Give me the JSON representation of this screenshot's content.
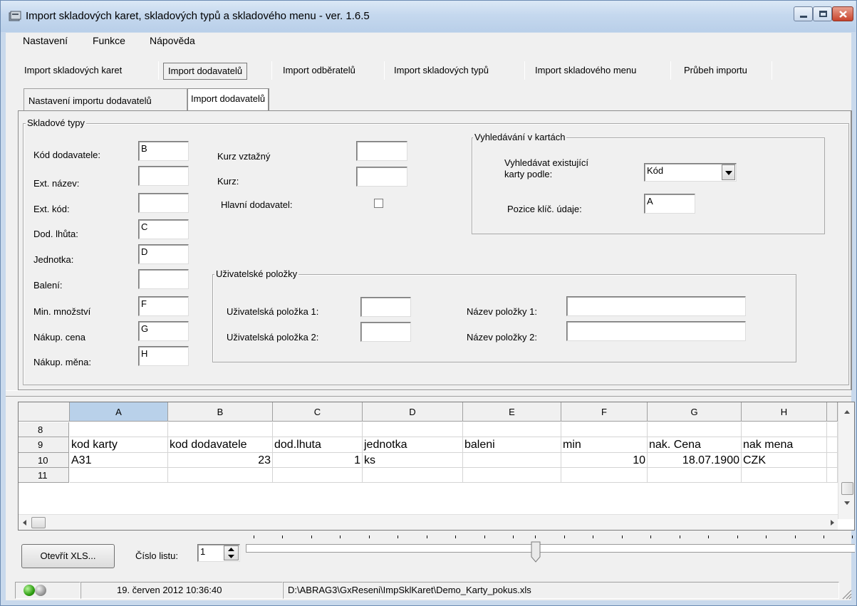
{
  "window": {
    "title": "Import skladových karet, skladových typů a skladového menu - ver. 1.6.5"
  },
  "menu": [
    "Nastavení",
    "Funkce",
    "Nápověda"
  ],
  "main_tabs": [
    "Import skladových karet",
    "Import dodavatelů",
    "Import odběratelů",
    "Import skladových typů",
    "Import skladového menu",
    "Průbeh importu"
  ],
  "sub_tabs": [
    "Nastavení importu dodavatelů",
    "Import dodavatelů"
  ],
  "skladove_typy": {
    "title": "Skladové typy",
    "fields": [
      {
        "label": "Kód dodavatele:",
        "value": "B"
      },
      {
        "label": "Ext. název:",
        "value": ""
      },
      {
        "label": "Ext. kód:",
        "value": ""
      },
      {
        "label": "Dod. lhůta:",
        "value": "C"
      },
      {
        "label": "Jednotka:",
        "value": "D"
      },
      {
        "label": "Balení:",
        "value": ""
      },
      {
        "label": "Min. množství",
        "value": "F"
      },
      {
        "label": "Nákup. cena",
        "value": "G"
      },
      {
        "label": "Nákup. měna:",
        "value": "H"
      }
    ],
    "kurz_vztazny_label": "Kurz vztažný",
    "kurz_vztazny_value": "",
    "kurz_label": "Kurz:",
    "kurz_value": "",
    "hlavni_dodavatel_label": "Hlavní dodavatel:"
  },
  "vyhledavani": {
    "title": "Vyhledávání v kartách",
    "search_label_1": "Vyhledávat existující",
    "search_label_2": "karty podle:",
    "search_value": "Kód",
    "pozice_label": "Pozice klíč. údaje:",
    "pozice_value": "A"
  },
  "uzivatelske": {
    "title": "Uživatelské položky",
    "polozka1_label": "Uživatelská položka 1:",
    "polozka1_value": "",
    "polozka2_label": "Uživatelská položka 2:",
    "polozka2_value": "",
    "nazev1_label": "Název položky 1:",
    "nazev1_value": "",
    "nazev2_label": "Název položky 2:",
    "nazev2_value": ""
  },
  "grid": {
    "columns": [
      "A",
      "B",
      "C",
      "D",
      "E",
      "F",
      "G",
      "H"
    ],
    "rows": [
      {
        "num": "8",
        "cells": [
          "",
          "",
          "",
          "",
          "",
          "",
          "",
          ""
        ]
      },
      {
        "num": "9",
        "cells": [
          "kod karty",
          "kod dodavatele",
          "dod.lhuta",
          "jednotka",
          "baleni",
          "min",
          "nak. Cena",
          "nak mena"
        ]
      },
      {
        "num": "10",
        "cells": [
          "A31",
          "23",
          "1",
          "ks",
          "",
          "10",
          "18.07.1900",
          "CZK"
        ]
      },
      {
        "num": "11",
        "cells": [
          "",
          "",
          "",
          "",
          "",
          "",
          "",
          ""
        ]
      }
    ]
  },
  "bottom": {
    "open_button": "Otevřít XLS...",
    "sheet_label": "Číslo listu:",
    "sheet_value": "1"
  },
  "status": {
    "datetime": "19. červen 2012 10:36:40",
    "path": "D:\\ABRAG3\\GxReseni\\ImpSklKaret\\Demo_Karty_pokus.xls"
  }
}
